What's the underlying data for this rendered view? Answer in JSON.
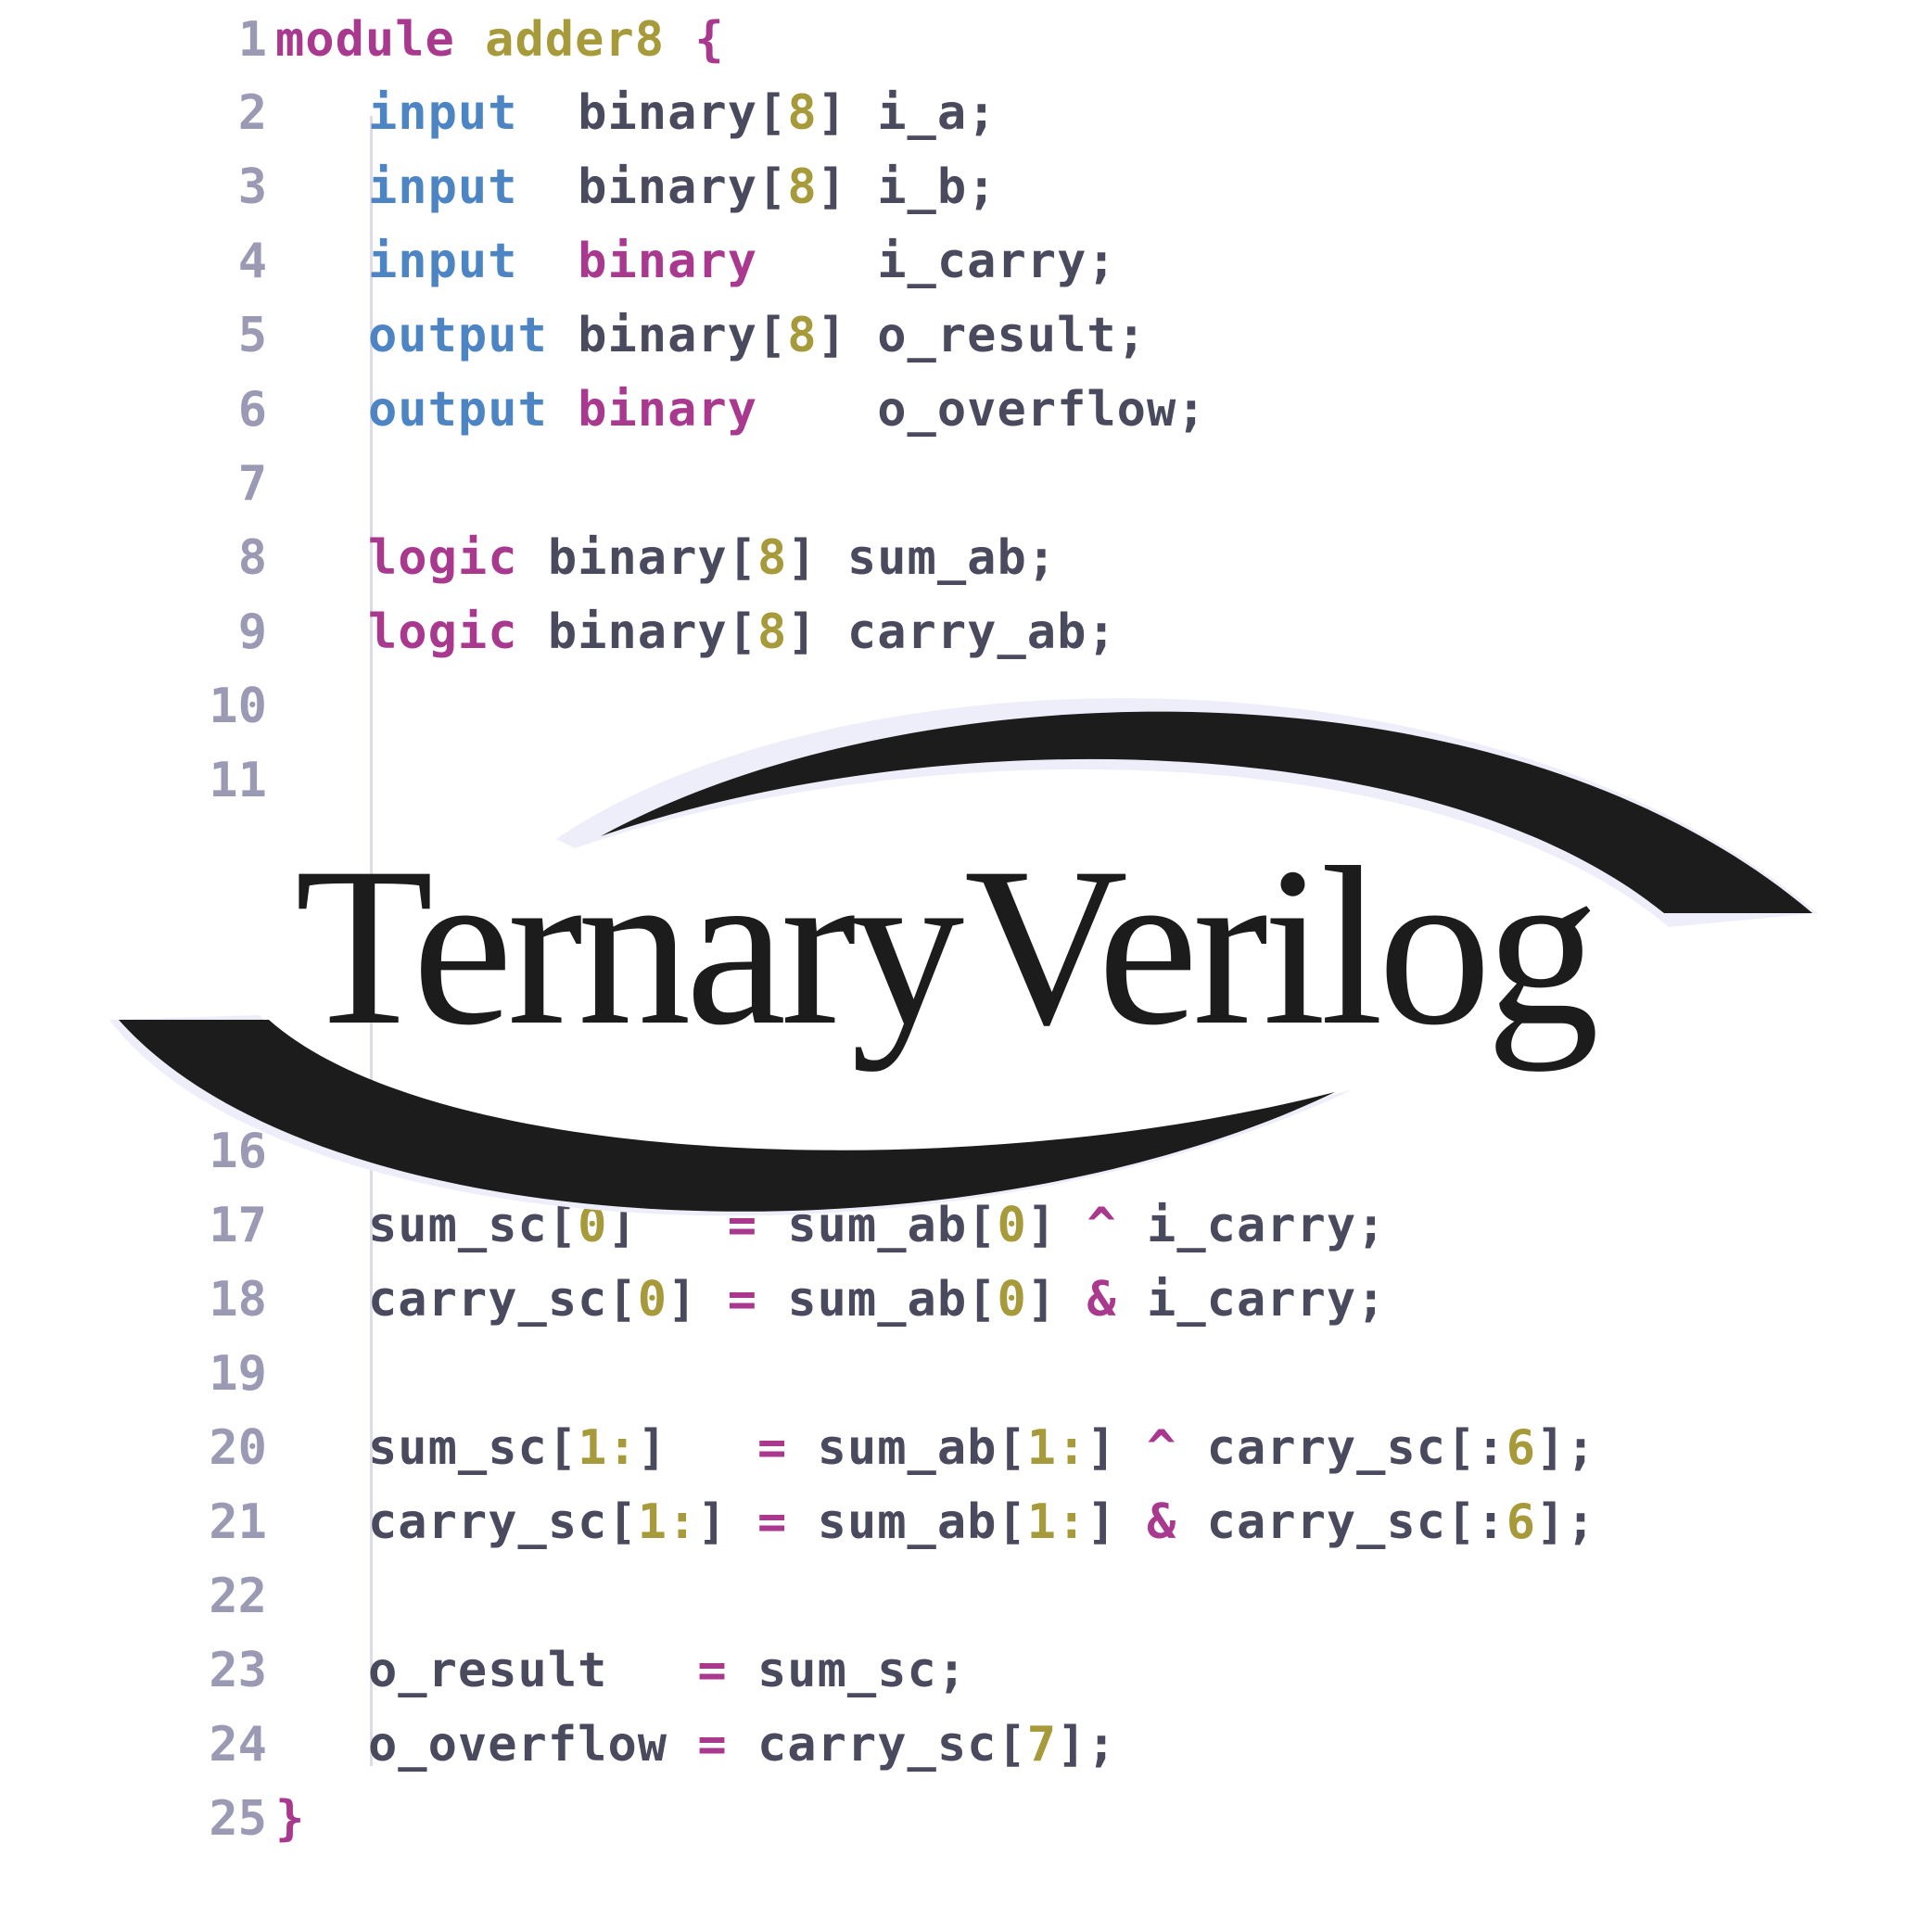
{
  "editor": {
    "lines": [
      {
        "n": "1",
        "indent": 0,
        "tokens": [
          {
            "t": "module",
            "c": "kw"
          },
          {
            "t": " "
          },
          {
            "t": "adder8",
            "c": "name"
          },
          {
            "t": " "
          },
          {
            "t": "{",
            "c": "kw"
          }
        ]
      },
      {
        "n": "2",
        "indent": 1,
        "tokens": [
          {
            "t": "input",
            "c": "io"
          },
          {
            "t": "  binary["
          },
          {
            "t": "8",
            "c": "num"
          },
          {
            "t": "] i_a;"
          }
        ]
      },
      {
        "n": "3",
        "indent": 1,
        "tokens": [
          {
            "t": "input",
            "c": "io"
          },
          {
            "t": "  binary["
          },
          {
            "t": "8",
            "c": "num"
          },
          {
            "t": "] i_b;"
          }
        ]
      },
      {
        "n": "4",
        "indent": 1,
        "tokens": [
          {
            "t": "input",
            "c": "io"
          },
          {
            "t": "  "
          },
          {
            "t": "binary",
            "c": "kw"
          },
          {
            "t": "    i_carry;"
          }
        ]
      },
      {
        "n": "5",
        "indent": 1,
        "tokens": [
          {
            "t": "output",
            "c": "io"
          },
          {
            "t": " binary["
          },
          {
            "t": "8",
            "c": "num"
          },
          {
            "t": "] o_result;"
          }
        ]
      },
      {
        "n": "6",
        "indent": 1,
        "tokens": [
          {
            "t": "output",
            "c": "io"
          },
          {
            "t": " "
          },
          {
            "t": "binary",
            "c": "kw"
          },
          {
            "t": "    o_overflow;"
          }
        ]
      },
      {
        "n": "7",
        "indent": 1,
        "tokens": []
      },
      {
        "n": "8",
        "indent": 1,
        "tokens": [
          {
            "t": "logic",
            "c": "kw"
          },
          {
            "t": " binary["
          },
          {
            "t": "8",
            "c": "num"
          },
          {
            "t": "] sum_ab;"
          }
        ]
      },
      {
        "n": "9",
        "indent": 1,
        "tokens": [
          {
            "t": "logic",
            "c": "kw"
          },
          {
            "t": " binary["
          },
          {
            "t": "8",
            "c": "num"
          },
          {
            "t": "] carry_ab;"
          }
        ]
      },
      {
        "n": "10",
        "indent": 1,
        "tokens": []
      },
      {
        "n": "11",
        "indent": 1,
        "tokens": []
      },
      {
        "n": "16",
        "indent": 1,
        "tokens": []
      },
      {
        "n": "17",
        "indent": 1,
        "tokens": [
          {
            "t": "sum_sc["
          },
          {
            "t": "0",
            "c": "num"
          },
          {
            "t": "]   "
          },
          {
            "t": "=",
            "c": "op"
          },
          {
            "t": " sum_ab["
          },
          {
            "t": "0",
            "c": "num"
          },
          {
            "t": "] "
          },
          {
            "t": "^",
            "c": "op"
          },
          {
            "t": " i_carry;"
          }
        ]
      },
      {
        "n": "18",
        "indent": 1,
        "tokens": [
          {
            "t": "carry_sc["
          },
          {
            "t": "0",
            "c": "num"
          },
          {
            "t": "] "
          },
          {
            "t": "=",
            "c": "op"
          },
          {
            "t": " sum_ab["
          },
          {
            "t": "0",
            "c": "num"
          },
          {
            "t": "] "
          },
          {
            "t": "&",
            "c": "op"
          },
          {
            "t": " i_carry;"
          }
        ]
      },
      {
        "n": "19",
        "indent": 1,
        "tokens": []
      },
      {
        "n": "20",
        "indent": 1,
        "tokens": [
          {
            "t": "sum_sc["
          },
          {
            "t": "1:",
            "c": "num"
          },
          {
            "t": "]   "
          },
          {
            "t": "=",
            "c": "op"
          },
          {
            "t": " sum_ab["
          },
          {
            "t": "1:",
            "c": "num"
          },
          {
            "t": "] "
          },
          {
            "t": "^",
            "c": "op"
          },
          {
            "t": " carry_sc[:"
          },
          {
            "t": "6",
            "c": "num"
          },
          {
            "t": "];"
          }
        ]
      },
      {
        "n": "21",
        "indent": 1,
        "tokens": [
          {
            "t": "carry_sc["
          },
          {
            "t": "1:",
            "c": "num"
          },
          {
            "t": "] "
          },
          {
            "t": "=",
            "c": "op"
          },
          {
            "t": " sum_ab["
          },
          {
            "t": "1:",
            "c": "num"
          },
          {
            "t": "] "
          },
          {
            "t": "&",
            "c": "op"
          },
          {
            "t": " carry_sc[:"
          },
          {
            "t": "6",
            "c": "num"
          },
          {
            "t": "];"
          }
        ]
      },
      {
        "n": "22",
        "indent": 1,
        "tokens": []
      },
      {
        "n": "23",
        "indent": 1,
        "tokens": [
          {
            "t": "o_result   "
          },
          {
            "t": "=",
            "c": "op"
          },
          {
            "t": " sum_sc;"
          }
        ]
      },
      {
        "n": "24",
        "indent": 1,
        "tokens": [
          {
            "t": "o_overflow "
          },
          {
            "t": "=",
            "c": "op"
          },
          {
            "t": " carry_sc["
          },
          {
            "t": "7",
            "c": "num"
          },
          {
            "t": "];"
          }
        ]
      },
      {
        "n": "25",
        "indent": 0,
        "tokens": [
          {
            "t": "}",
            "c": "kw"
          }
        ]
      }
    ]
  },
  "logo": {
    "text": "Ternary Verilog",
    "word1": "Ternary",
    "word2": "Verilog",
    "ink": "#1c1c1c",
    "halo": "#eeeefa"
  },
  "colors": {
    "keyword": "#a8398e",
    "io": "#4d84c4",
    "number": "#a69a3a",
    "identifier": "#4a4a5e",
    "line_number": "#9a9ab4",
    "guide": "#dcdce8"
  }
}
